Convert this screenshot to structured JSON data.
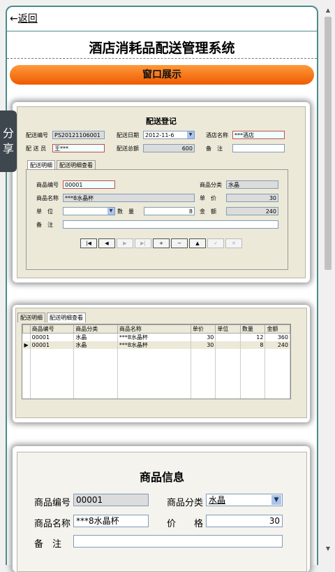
{
  "nav": {
    "back_arrow": "←",
    "back_label": "返回"
  },
  "page_title": "酒店消耗品配送管理系统",
  "section_button": "窗口展示",
  "share_label": "分享",
  "card1": {
    "title": "配送登记",
    "fields": {
      "delivery_no_label": "配送编号",
      "delivery_no": "PS20121106001",
      "delivery_date_label": "配送日期",
      "delivery_date": "2012-11-6",
      "hotel_label": "酒店名称",
      "hotel": "***酒店",
      "staff_label": "配 送 员",
      "staff": "王***",
      "total_label": "配送总额",
      "total": "600",
      "remark_label": "备　注",
      "remark": ""
    },
    "tabs": [
      "配送明细",
      "配送明细查看"
    ],
    "detail": {
      "code_label": "商品编号",
      "code": "00001",
      "category_label": "商品分类",
      "category": "水晶",
      "name_label": "商品名称",
      "name": "***8水晶杯",
      "price_label": "单　价",
      "price": "30",
      "unit_label": "单　位",
      "unit": "",
      "qty_label": "数　量",
      "qty": "8",
      "amount_label": "金　额",
      "amount": "240",
      "remark_label": "备　注",
      "remark": ""
    },
    "nav_buttons": [
      "|◀",
      "◀",
      "▶",
      "▶|",
      "+",
      "−",
      "▲",
      "✓",
      "✕"
    ]
  },
  "card2": {
    "tabs": [
      "配送明细",
      "配送明细查看"
    ],
    "columns": [
      "商品编号",
      "商品分类",
      "商品名称",
      "单价",
      "单位",
      "数量",
      "金额"
    ],
    "rows": [
      {
        "marker": "",
        "code": "00001",
        "category": "水晶",
        "name": "***8水晶杯",
        "price": "30",
        "unit": "",
        "qty": "12",
        "amount": "360"
      },
      {
        "marker": "▶",
        "code": "00001",
        "category": "水晶",
        "name": "***8水晶杯",
        "price": "30",
        "unit": "",
        "qty": "8",
        "amount": "240"
      }
    ]
  },
  "card3": {
    "title": "商品信息",
    "code_label": "商品编号",
    "code": "00001",
    "category_label": "商品分类",
    "category": "水晶",
    "name_label": "商品名称",
    "name": "***8水晶杯",
    "price_label": "价　　格",
    "price": "30",
    "remark_label": "备　注",
    "remark": ""
  }
}
